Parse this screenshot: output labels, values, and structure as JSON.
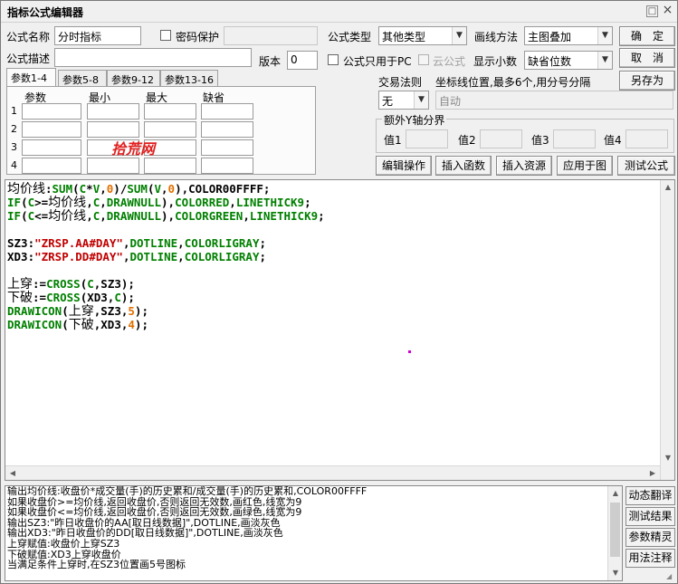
{
  "window": {
    "title": "指标公式编辑器",
    "maximize_glyph": "□",
    "close_glyph": "×"
  },
  "form": {
    "name_label": "公式名称",
    "name_value": "分时指标",
    "password_label": "密码保护",
    "password_checked": false,
    "type_label": "公式类型",
    "type_value": "其他类型",
    "draw_label": "画线方法",
    "draw_value": "主图叠加",
    "desc_label": "公式描述",
    "desc_value": "",
    "version_label": "版本",
    "version_value": "0",
    "pc_only_label": "公式只用于PC",
    "pc_only_checked": false,
    "cloud_label": "云公式",
    "cloud_checked": false,
    "decimals_label": "显示小数",
    "decimals_value": "缺省位数"
  },
  "buttons": {
    "ok": "确　定",
    "cancel": "取　消",
    "save_as": "另存为",
    "edit_ops": "编辑操作",
    "insert_func": "插入函数",
    "insert_res": "插入资源",
    "apply_chart": "应用于图",
    "test_formula": "测试公式",
    "dynamic_translate": "动态翻译",
    "test_result": "测试结果",
    "param_wizard": "参数精灵",
    "usage_notes": "用法注释"
  },
  "params": {
    "tabs": [
      "参数1-4",
      "参数5-8",
      "参数9-12",
      "参数13-16"
    ],
    "active_tab": 0,
    "headers": [
      "参数",
      "最小",
      "最大",
      "缺省"
    ],
    "rows": [
      "1",
      "2",
      "3",
      "4"
    ],
    "watermark": "拾荒网"
  },
  "trade": {
    "rule_label": "交易法则",
    "rule_value": "无",
    "coord_label": "坐标线位置,最多6个,用分号分隔",
    "coord_value": "自动",
    "yaxis_group_label": "额外Y轴分界",
    "v1_label": "值1",
    "v2_label": "值2",
    "v3_label": "值3",
    "v4_label": "值4"
  },
  "code_lines": [
    [
      [
        "big",
        "均价线"
      ],
      [
        "def",
        ":"
      ],
      [
        "kw",
        "SUM"
      ],
      [
        "def",
        "("
      ],
      [
        "kw",
        "C"
      ],
      [
        "def",
        "*"
      ],
      [
        "kw",
        "V"
      ],
      [
        "def",
        ","
      ],
      [
        "num",
        "0"
      ],
      [
        "def",
        ")/"
      ],
      [
        "kw",
        "SUM"
      ],
      [
        "def",
        "("
      ],
      [
        "kw",
        "V"
      ],
      [
        "def",
        ","
      ],
      [
        "num",
        "0"
      ],
      [
        "def",
        "),COLOR00FFFF;"
      ]
    ],
    [
      [
        "kw",
        "IF"
      ],
      [
        "def",
        "("
      ],
      [
        "kw",
        "C"
      ],
      [
        "def",
        ">="
      ],
      [
        "big",
        "均价线"
      ],
      [
        "def",
        ","
      ],
      [
        "kw",
        "C"
      ],
      [
        "def",
        ","
      ],
      [
        "kw",
        "DRAWNULL"
      ],
      [
        "def",
        "),"
      ],
      [
        "kw",
        "COLORRED"
      ],
      [
        "def",
        ","
      ],
      [
        "kw",
        "LINETHICK9"
      ],
      [
        "def",
        ";"
      ]
    ],
    [
      [
        "kw",
        "IF"
      ],
      [
        "def",
        "("
      ],
      [
        "kw",
        "C"
      ],
      [
        "def",
        "<="
      ],
      [
        "big",
        "均价线"
      ],
      [
        "def",
        ","
      ],
      [
        "kw",
        "C"
      ],
      [
        "def",
        ","
      ],
      [
        "kw",
        "DRAWNULL"
      ],
      [
        "def",
        "),"
      ],
      [
        "kw",
        "COLORGREEN"
      ],
      [
        "def",
        ","
      ],
      [
        "kw",
        "LINETHICK9"
      ],
      [
        "def",
        ";"
      ]
    ],
    [],
    [
      [
        "def",
        "SZ3:"
      ],
      [
        "str",
        "\"ZRSP.AA#DAY\""
      ],
      [
        "def",
        ","
      ],
      [
        "kw",
        "DOTLINE"
      ],
      [
        "def",
        ","
      ],
      [
        "kw",
        "COLORLIGRAY"
      ],
      [
        "def",
        ";"
      ]
    ],
    [
      [
        "def",
        "XD3:"
      ],
      [
        "str",
        "\"ZRSP.DD#DAY\""
      ],
      [
        "def",
        ","
      ],
      [
        "kw",
        "DOTLINE"
      ],
      [
        "def",
        ","
      ],
      [
        "kw",
        "COLORLIGRAY"
      ],
      [
        "def",
        ";"
      ]
    ],
    [],
    [
      [
        "big",
        "上穿"
      ],
      [
        "def",
        ":="
      ],
      [
        "kw",
        "CROSS"
      ],
      [
        "def",
        "("
      ],
      [
        "kw",
        "C"
      ],
      [
        "def",
        ",SZ3);"
      ]
    ],
    [
      [
        "big",
        "下破"
      ],
      [
        "def",
        ":="
      ],
      [
        "kw",
        "CROSS"
      ],
      [
        "def",
        "(XD3,"
      ],
      [
        "kw",
        "C"
      ],
      [
        "def",
        ");"
      ]
    ],
    [
      [
        "kw",
        "DRAWICON"
      ],
      [
        "def",
        "("
      ],
      [
        "big",
        "上穿"
      ],
      [
        "def",
        ",SZ3,"
      ],
      [
        "num",
        "5"
      ],
      [
        "def",
        ");"
      ]
    ],
    [
      [
        "kw",
        "DRAWICON"
      ],
      [
        "def",
        "("
      ],
      [
        "big",
        "下破"
      ],
      [
        "def",
        ",XD3,"
      ],
      [
        "num",
        "4"
      ],
      [
        "def",
        ");"
      ]
    ]
  ],
  "output_lines": [
    "输出均价线:收盘价*成交量(手)的历史累和/成交量(手)的历史累和,COLOR00FFFF",
    "如果收盘价>=均价线,返回收盘价,否则返回无效数,画红色,线宽为9",
    "如果收盘价<=均价线,返回收盘价,否则返回无效数,画绿色,线宽为9",
    "输出SZ3:\"昨日收盘价的AA[取日线数据]\",DOTLINE,画淡灰色",
    "输出XD3:\"昨日收盘价的DD[取日线数据]\",DOTLINE,画淡灰色",
    "上穿赋值:收盘价上穿SZ3",
    "下破赋值:XD3上穿收盘价",
    "当满足条件上穿时,在SZ3位置画5号图标"
  ],
  "colors": {
    "keyword": "#008000",
    "string": "#c00000",
    "number": "#e07000",
    "watermark": "#e02020"
  }
}
